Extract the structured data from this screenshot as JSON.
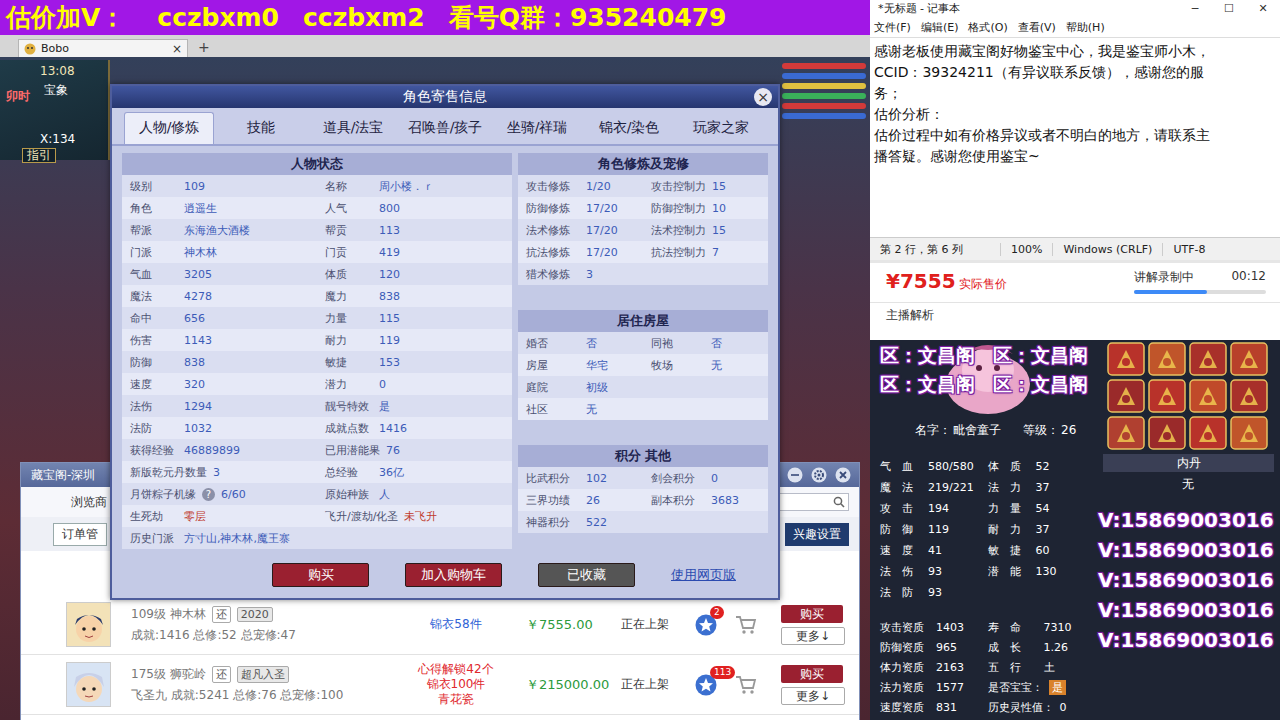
{
  "banner": {
    "prefix": "估价加V：",
    "wechat": [
      "cczbxm0",
      "cczbxm2"
    ],
    "group_label": "看号Q群：",
    "group": "935240479"
  },
  "game": {
    "tab_title": "Bobo",
    "tab_close": "×",
    "tab_add": "+",
    "time": "13:08",
    "map": "宝象",
    "shichen": "卯时",
    "coord": "X:134",
    "guide": "指引"
  },
  "dialog": {
    "title": "角色寄售信息",
    "close": "×",
    "tabs": [
      {
        "label": "人物/修炼",
        "selected": true
      },
      {
        "label": "技能",
        "selected": false
      },
      {
        "label": "道具/法宝",
        "selected": false
      },
      {
        "label": "召唤兽/孩子",
        "selected": false
      },
      {
        "label": "坐骑/祥瑞",
        "selected": false
      },
      {
        "label": "锦衣/染色",
        "selected": false
      },
      {
        "label": "玩家之家",
        "selected": false
      }
    ],
    "status": {
      "title": "人物状态",
      "rows": [
        [
          {
            "label": "级别",
            "value": "109"
          },
          {
            "label": "名称",
            "value": "周小楼．ｒ"
          }
        ],
        [
          {
            "label": "角色",
            "value": "逍遥生"
          },
          {
            "label": "人气",
            "value": "800"
          }
        ],
        [
          {
            "label": "帮派",
            "value": "东海渔大酒楼"
          },
          {
            "label": "帮贡",
            "value": "113"
          }
        ],
        [
          {
            "label": "门派",
            "value": "神木林"
          },
          {
            "label": "门贡",
            "value": "419"
          }
        ],
        [
          {
            "label": "气血",
            "value": "3205"
          },
          {
            "label": "体质",
            "value": "120"
          }
        ],
        [
          {
            "label": "魔法",
            "value": "4278"
          },
          {
            "label": "魔力",
            "value": "838"
          }
        ],
        [
          {
            "label": "命中",
            "value": "656"
          },
          {
            "label": "力量",
            "value": "115"
          }
        ],
        [
          {
            "label": "伤害",
            "value": "1143"
          },
          {
            "label": "耐力",
            "value": "119"
          }
        ],
        [
          {
            "label": "防御",
            "value": "838"
          },
          {
            "label": "敏捷",
            "value": "153"
          }
        ],
        [
          {
            "label": "速度",
            "value": "320"
          },
          {
            "label": "潜力",
            "value": "0"
          }
        ],
        [
          {
            "label": "法伤",
            "value": "1294"
          },
          {
            "label": "靓号特效",
            "value": "是"
          }
        ],
        [
          {
            "label": "法防",
            "value": "1032"
          },
          {
            "label": "成就点数",
            "value": "1416"
          }
        ],
        [
          {
            "label": "获得经验",
            "value": "46889899"
          },
          {
            "label": "已用潜能果",
            "value": "76"
          }
        ],
        [
          {
            "label": "新版乾元丹数量",
            "value": "3"
          },
          {
            "label": "总经验",
            "value": "36亿"
          }
        ],
        [
          {
            "label": "月饼粽子机缘",
            "help": "?",
            "value": "6/60"
          },
          {
            "label": "原始种族",
            "value": "人"
          }
        ],
        [
          {
            "label": "生死劫",
            "value": "零层",
            "color": "#c0392b"
          },
          {
            "label": "飞升/渡劫/化圣",
            "value": "未飞升",
            "color": "#c0392b"
          }
        ]
      ],
      "history": {
        "label": "历史门派",
        "value": "方寸山,神木林,魔王寨"
      }
    },
    "cultivation": {
      "title": "角色修炼及宠修",
      "rows": [
        [
          {
            "label": "攻击修炼",
            "value": "1/20"
          },
          {
            "label": "攻击控制力",
            "value": "15"
          }
        ],
        [
          {
            "label": "防御修炼",
            "value": "17/20"
          },
          {
            "label": "防御控制力",
            "value": "10"
          }
        ],
        [
          {
            "label": "法术修炼",
            "value": "17/20"
          },
          {
            "label": "法术控制力",
            "value": "15"
          }
        ],
        [
          {
            "label": "抗法修炼",
            "value": "17/20"
          },
          {
            "label": "抗法控制力",
            "value": "7"
          }
        ],
        [
          {
            "label": "猎术修炼",
            "value": "3"
          }
        ]
      ]
    },
    "house": {
      "title": "居住房屋",
      "rows": [
        [
          {
            "label": "婚否",
            "value": "否"
          },
          {
            "label": "同袍",
            "value": "否"
          }
        ],
        [
          {
            "label": "房屋",
            "value": "华宅"
          },
          {
            "label": "牧场",
            "value": "无"
          }
        ],
        [
          {
            "label": "庭院",
            "value": "初级"
          }
        ],
        [
          {
            "label": "社区",
            "value": "无"
          }
        ]
      ]
    },
    "points": {
      "title": "积分 其他",
      "rows": [
        [
          {
            "label": "比武积分",
            "value": "102"
          },
          {
            "label": "剑会积分",
            "value": "0"
          }
        ],
        [
          {
            "label": "三界功绩",
            "value": "26"
          },
          {
            "label": "副本积分",
            "value": "3683"
          }
        ],
        [
          {
            "label": "神器积分",
            "value": "522"
          }
        ]
      ]
    },
    "buttons": {
      "buy": "购买",
      "cart": "加入购物车",
      "favorited": "已收藏",
      "web": "使用网页版"
    }
  },
  "market": {
    "title": "藏宝阁-深圳",
    "browse": "浏览商",
    "orders": "订单管",
    "interest": "兴趣设置",
    "rows": [
      {
        "title": "109级 神木林",
        "tags": [
          "还",
          "2020"
        ],
        "summary": "成就:1416 总修:52 总宠修:47",
        "info": [
          "锦衣58件"
        ],
        "info_color": "#2f62d6",
        "price": "￥7555.00",
        "status": "正在上架",
        "favorites": "2",
        "buy": "购买",
        "more": "更多↓"
      },
      {
        "title": "175级 狮驼岭",
        "tags": [
          "还",
          "超凡入圣"
        ],
        "summary": "飞圣九 成就:5241 总修:76 总宠修:100",
        "info": [
          "心得解锁42个",
          "锦衣100件",
          "青花瓷"
        ],
        "info_color": "#e0282e",
        "price": "￥215000.00",
        "status": "正在上架",
        "favorites": "113",
        "buy": "购买",
        "more": "更多↓"
      }
    ]
  },
  "notepad": {
    "title": "*无标题 - 记事本",
    "controls": [
      "─",
      "☐",
      "✕"
    ],
    "menu": [
      "文件(F)",
      "编辑(E)",
      "格式(O)",
      "查看(V)",
      "帮助(H)"
    ],
    "lines": [
      "感谢老板使用藏宝阁好物鉴宝中心，我是鉴宝师小木，",
      "CCID：39324211（有异议联系反馈），感谢您的服",
      "务；",
      "估价分析：",
      "估价过程中如有价格异议或者不明白的地方，请联系主",
      "播答疑。感谢您使用鉴宝~"
    ],
    "status": [
      "第 2 行，第 6 列",
      "100%",
      "Windows (CRLF)",
      "UTF-8"
    ]
  },
  "price_panel": {
    "price": "¥7555",
    "price_label": "实际售价",
    "recording": "讲解录制中",
    "timer": "00:12",
    "level": 0.55,
    "analysis": "主播解析"
  },
  "pet": {
    "zones": [
      "区：文昌阁",
      "区：文昌阁",
      "区：文昌阁",
      "区：文昌阁"
    ],
    "name_label": "名字：",
    "name": "毗舍童子",
    "level_label": "等级：",
    "level": "26",
    "stats": [
      [
        {
          "label": "气　血",
          "value": "580/580"
        },
        {
          "label": "体　质",
          "value": "52"
        }
      ],
      [
        {
          "label": "魔　法",
          "value": "219/221"
        },
        {
          "label": "法　力",
          "value": "37"
        }
      ],
      [
        {
          "label": "攻　击",
          "value": "194"
        },
        {
          "label": "力　量",
          "value": "54"
        }
      ],
      [
        {
          "label": "防　御",
          "value": "119"
        },
        {
          "label": "耐　力",
          "value": "37"
        }
      ],
      [
        {
          "label": "速　度",
          "value": "41"
        },
        {
          "label": "敏　捷",
          "value": "60"
        }
      ],
      [
        {
          "label": "法　伤",
          "value": "93"
        },
        {
          "label": "潜　能",
          "value": "130"
        }
      ],
      [
        {
          "label": "法　防",
          "value": "93"
        }
      ]
    ],
    "aptitudes": [
      [
        {
          "label": "攻击资质",
          "value": "1403"
        },
        {
          "label": "寿　命",
          "value": "7310"
        }
      ],
      [
        {
          "label": "防御资质",
          "value": "965"
        },
        {
          "label": "成　长",
          "value": "1.26"
        }
      ],
      [
        {
          "label": "体力资质",
          "value": "2163"
        },
        {
          "label": "五　行",
          "value": "土"
        }
      ],
      [
        {
          "label": "法力资质",
          "value": "1577"
        },
        {
          "label": "是否宝宝：",
          "value": "是",
          "color": "#d9822b"
        }
      ],
      [
        {
          "label": "速度资质",
          "value": "831"
        },
        {
          "label": "历史灵性值：",
          "value": "0"
        }
      ]
    ],
    "core": {
      "title": "内丹",
      "value": "无"
    },
    "watermarks": [
      "V:15869003016",
      "V:15869003016",
      "V:15869003016",
      "V:15869003016",
      "V:15869003016"
    ]
  }
}
